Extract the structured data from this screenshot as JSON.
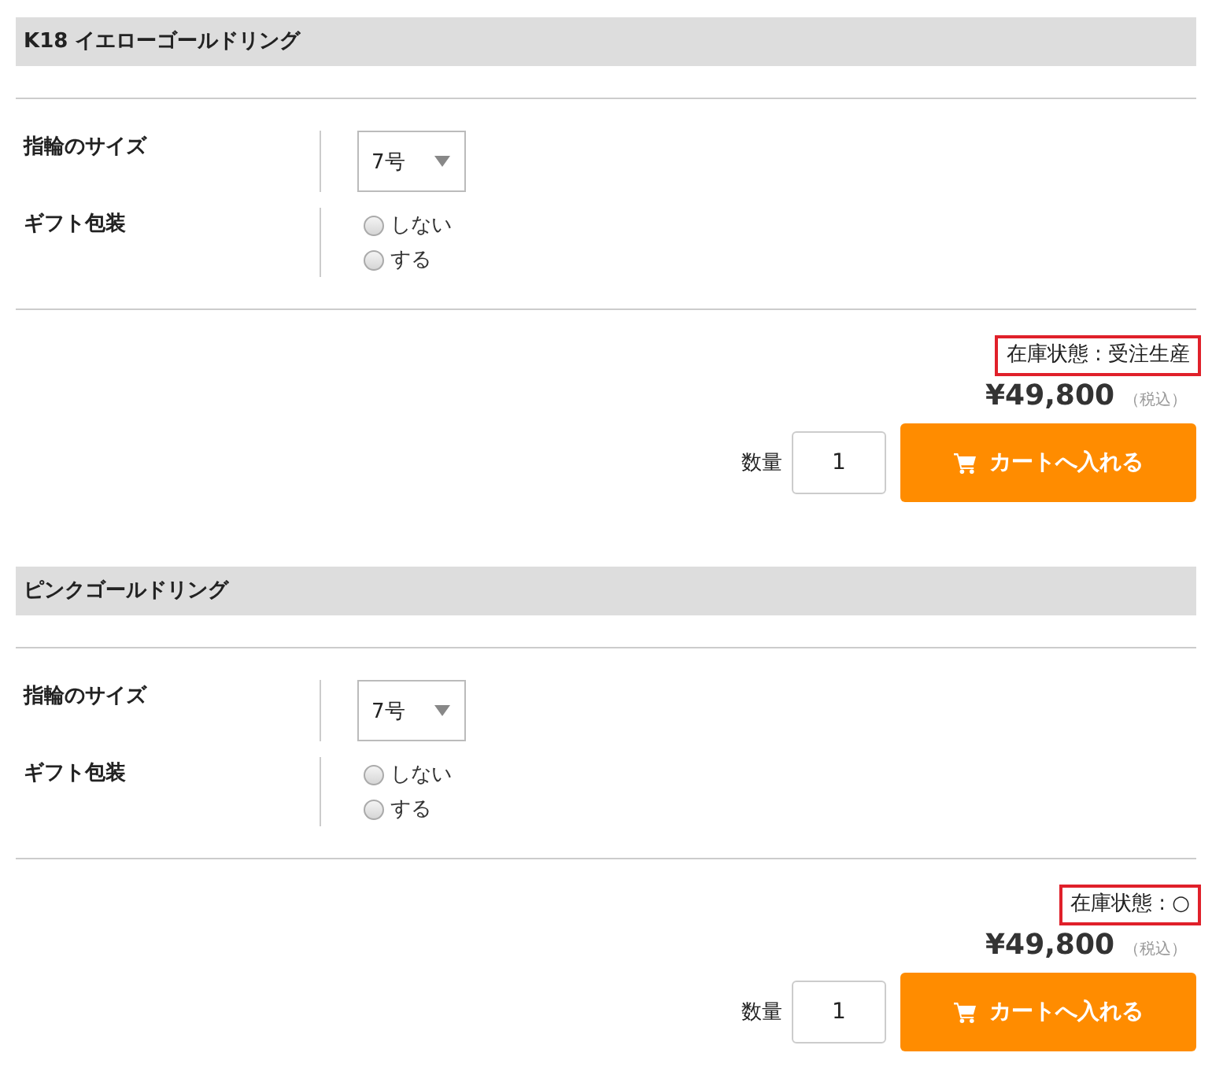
{
  "products": [
    {
      "title": "K18 イエローゴールドリング",
      "options": [
        {
          "kind": "select",
          "label": "指輪のサイズ",
          "value": "7号"
        },
        {
          "kind": "radio",
          "label": "ギフト包装",
          "choices": [
            {
              "label": "しない",
              "selected": false
            },
            {
              "label": "する",
              "selected": false
            }
          ]
        }
      ],
      "stock": "在庫状態 : 受注生産",
      "price": "¥49,800",
      "tax_note": "（税込）",
      "quantity_label": "数量",
      "quantity": "1",
      "cart_button": "カートへ入れる"
    },
    {
      "title": "ピンクゴールドリング",
      "options": [
        {
          "kind": "select",
          "label": "指輪のサイズ",
          "value": "7号"
        },
        {
          "kind": "radio",
          "label": "ギフト包装",
          "choices": [
            {
              "label": "しない",
              "selected": false
            },
            {
              "label": "する",
              "selected": false
            }
          ]
        }
      ],
      "stock": "在庫状態 : ○",
      "price": "¥49,800",
      "tax_note": "（税込）",
      "quantity_label": "数量",
      "quantity": "1",
      "cart_button": "カートへ入れる"
    }
  ]
}
